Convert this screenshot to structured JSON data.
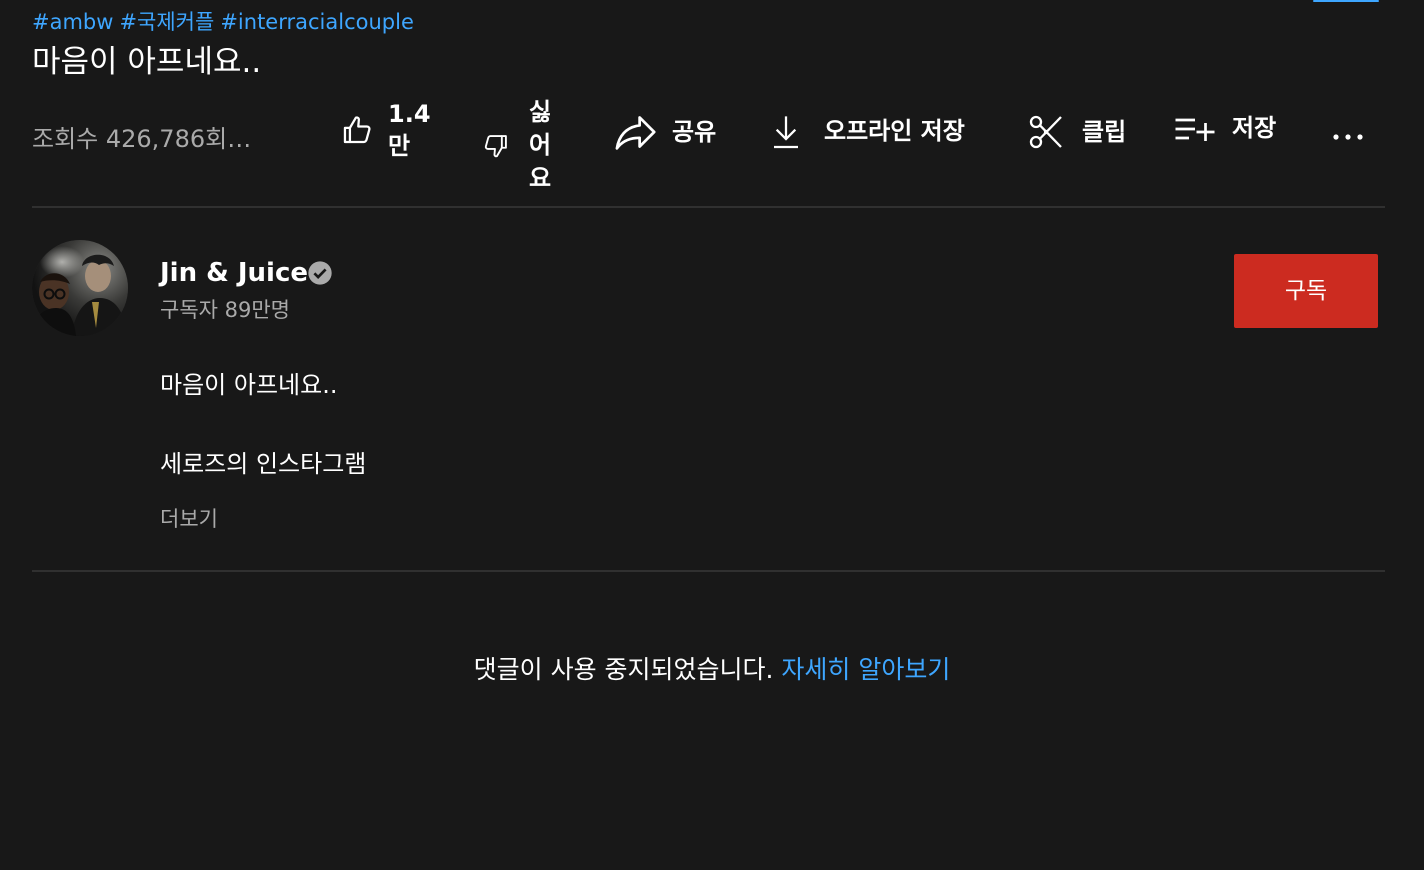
{
  "video": {
    "hashtags": [
      "#ambw",
      "#국제커플",
      "#interracialcouple"
    ],
    "title": "마음이 아프네요..",
    "views": "조회수 426,786회 ..."
  },
  "actions": {
    "like_count": "1.4만",
    "dislike_label": "싫어요",
    "share_label": "공유",
    "download_label": "오프라인 저장",
    "clip_label": "클립",
    "save_label": "저장",
    "more_label": "..."
  },
  "channel": {
    "name": "Jin & Juice",
    "subscribers": "구독자 89만명",
    "subscribe_label": "구독"
  },
  "description": {
    "line1": "마음이 아프네요..",
    "line2": "세로즈의 인스타그램",
    "more": "더보기"
  },
  "comments": {
    "disabled_text": "댓글이 사용 중지되었습니다.",
    "learn_more": "자세히 알아보기"
  },
  "colors": {
    "background": "#181818",
    "link": "#3ea6ff",
    "subscribe": "#cc2b20",
    "secondary_text": "#aaaaaa"
  },
  "icons": [
    "thumbs-up-icon",
    "thumbs-down-icon",
    "share-icon",
    "download-icon",
    "scissors-icon",
    "playlist-add-icon",
    "more-icon",
    "verified-icon"
  ]
}
